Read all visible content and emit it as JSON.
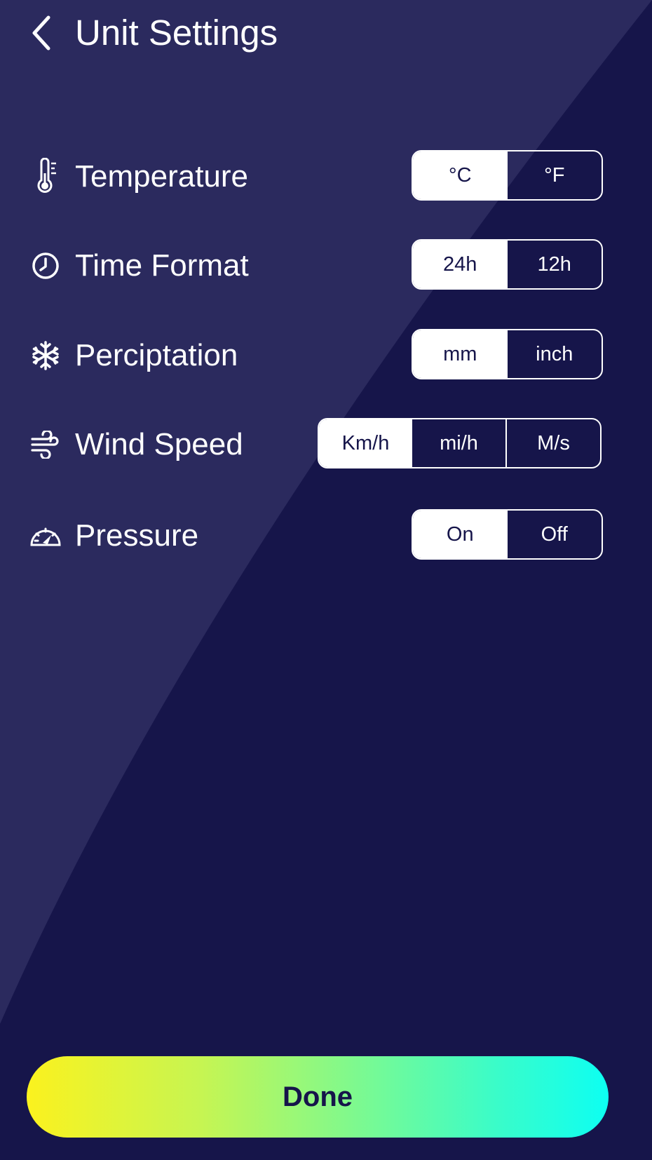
{
  "header": {
    "title": "Unit Settings",
    "back_icon": "chevron-left-icon"
  },
  "settings": [
    {
      "key": "temperature",
      "icon": "thermometer-icon",
      "label": "Temperature",
      "options": [
        "°C",
        "°F"
      ],
      "selected": "°C"
    },
    {
      "key": "time-format",
      "icon": "clock-icon",
      "label": "Time Format",
      "options": [
        "24h",
        "12h"
      ],
      "selected": "24h"
    },
    {
      "key": "precipitation",
      "icon": "snowflake-icon",
      "label": "Perciptation",
      "options": [
        "mm",
        "inch"
      ],
      "selected": "mm"
    },
    {
      "key": "wind-speed",
      "icon": "wind-icon",
      "label": "Wind Speed",
      "options": [
        "Km/h",
        "mi/h",
        "M/s"
      ],
      "selected": "Km/h"
    },
    {
      "key": "pressure",
      "icon": "gauge-icon",
      "label": "Pressure",
      "options": [
        "On",
        "Off"
      ],
      "selected": "On"
    }
  ],
  "footer": {
    "done_label": "Done"
  },
  "colors": {
    "background": "#16154a",
    "background_light": "#2b2a5e",
    "text": "#ffffff",
    "gradient_start": "#fbf21e",
    "gradient_end": "#0dfff2"
  }
}
